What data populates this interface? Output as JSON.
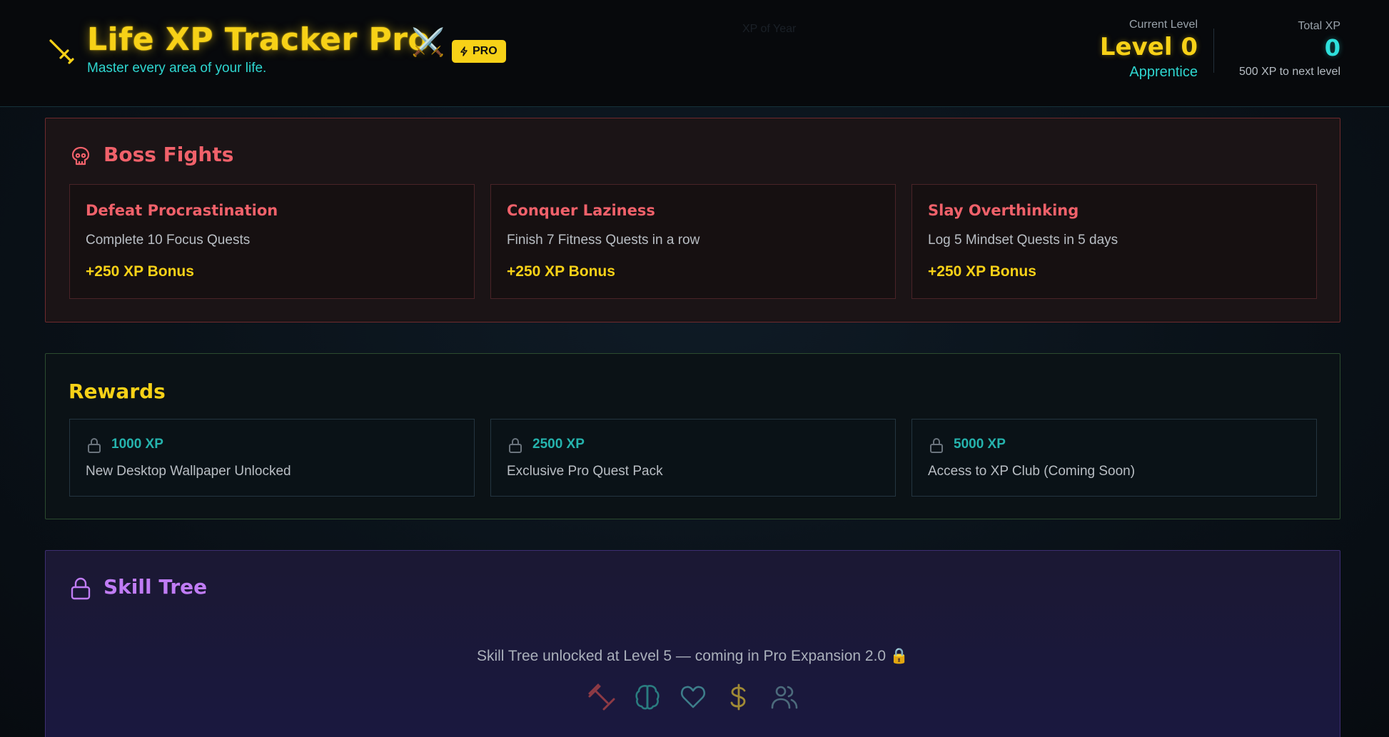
{
  "header": {
    "title": "Life XP Tracker Pro",
    "title_emoji": "⚔️",
    "pro_badge": "PRO",
    "tagline": "Master every area of your life.",
    "ghost_text": "XP of Year",
    "current_level_caption": "Current Level",
    "current_level_value": "Level 0",
    "current_rank": "Apprentice",
    "total_xp_caption": "Total XP",
    "total_xp_value": "0",
    "xp_to_next": "500 XP to next level"
  },
  "boss_fights": {
    "title": "Boss Fights",
    "icon": "skull-icon",
    "cards": [
      {
        "title": "Defeat Procrastination",
        "desc": "Complete 10 Focus Quests",
        "bonus": "+250 XP Bonus"
      },
      {
        "title": "Conquer Laziness",
        "desc": "Finish 7 Fitness Quests in a row",
        "bonus": "+250 XP Bonus"
      },
      {
        "title": "Slay Overthinking",
        "desc": "Log 5 Mindset Quests in 5 days",
        "bonus": "+250 XP Bonus"
      }
    ]
  },
  "rewards": {
    "title": "Rewards",
    "items": [
      {
        "xp": "1000 XP",
        "desc": "New Desktop Wallpaper Unlocked",
        "icon": "lock-icon"
      },
      {
        "xp": "2500 XP",
        "desc": "Exclusive Pro Quest Pack",
        "icon": "lock-icon"
      },
      {
        "xp": "5000 XP",
        "desc": "Access to XP Club (Coming Soon)",
        "icon": "lock-icon"
      }
    ]
  },
  "skill_tree": {
    "title": "Skill Tree",
    "icon": "lock-icon",
    "message": "Skill Tree unlocked at Level 5 — coming in Pro Expansion 2.0 🔒",
    "icons": [
      "dumbbell-icon",
      "brain-icon",
      "heart-icon",
      "dollar-icon",
      "users-icon"
    ]
  },
  "colors": {
    "accent_yellow": "#f7d117",
    "accent_cyan": "#2ed6d0",
    "boss_red": "#f0616a",
    "skill_purple": "#c07cf5"
  }
}
